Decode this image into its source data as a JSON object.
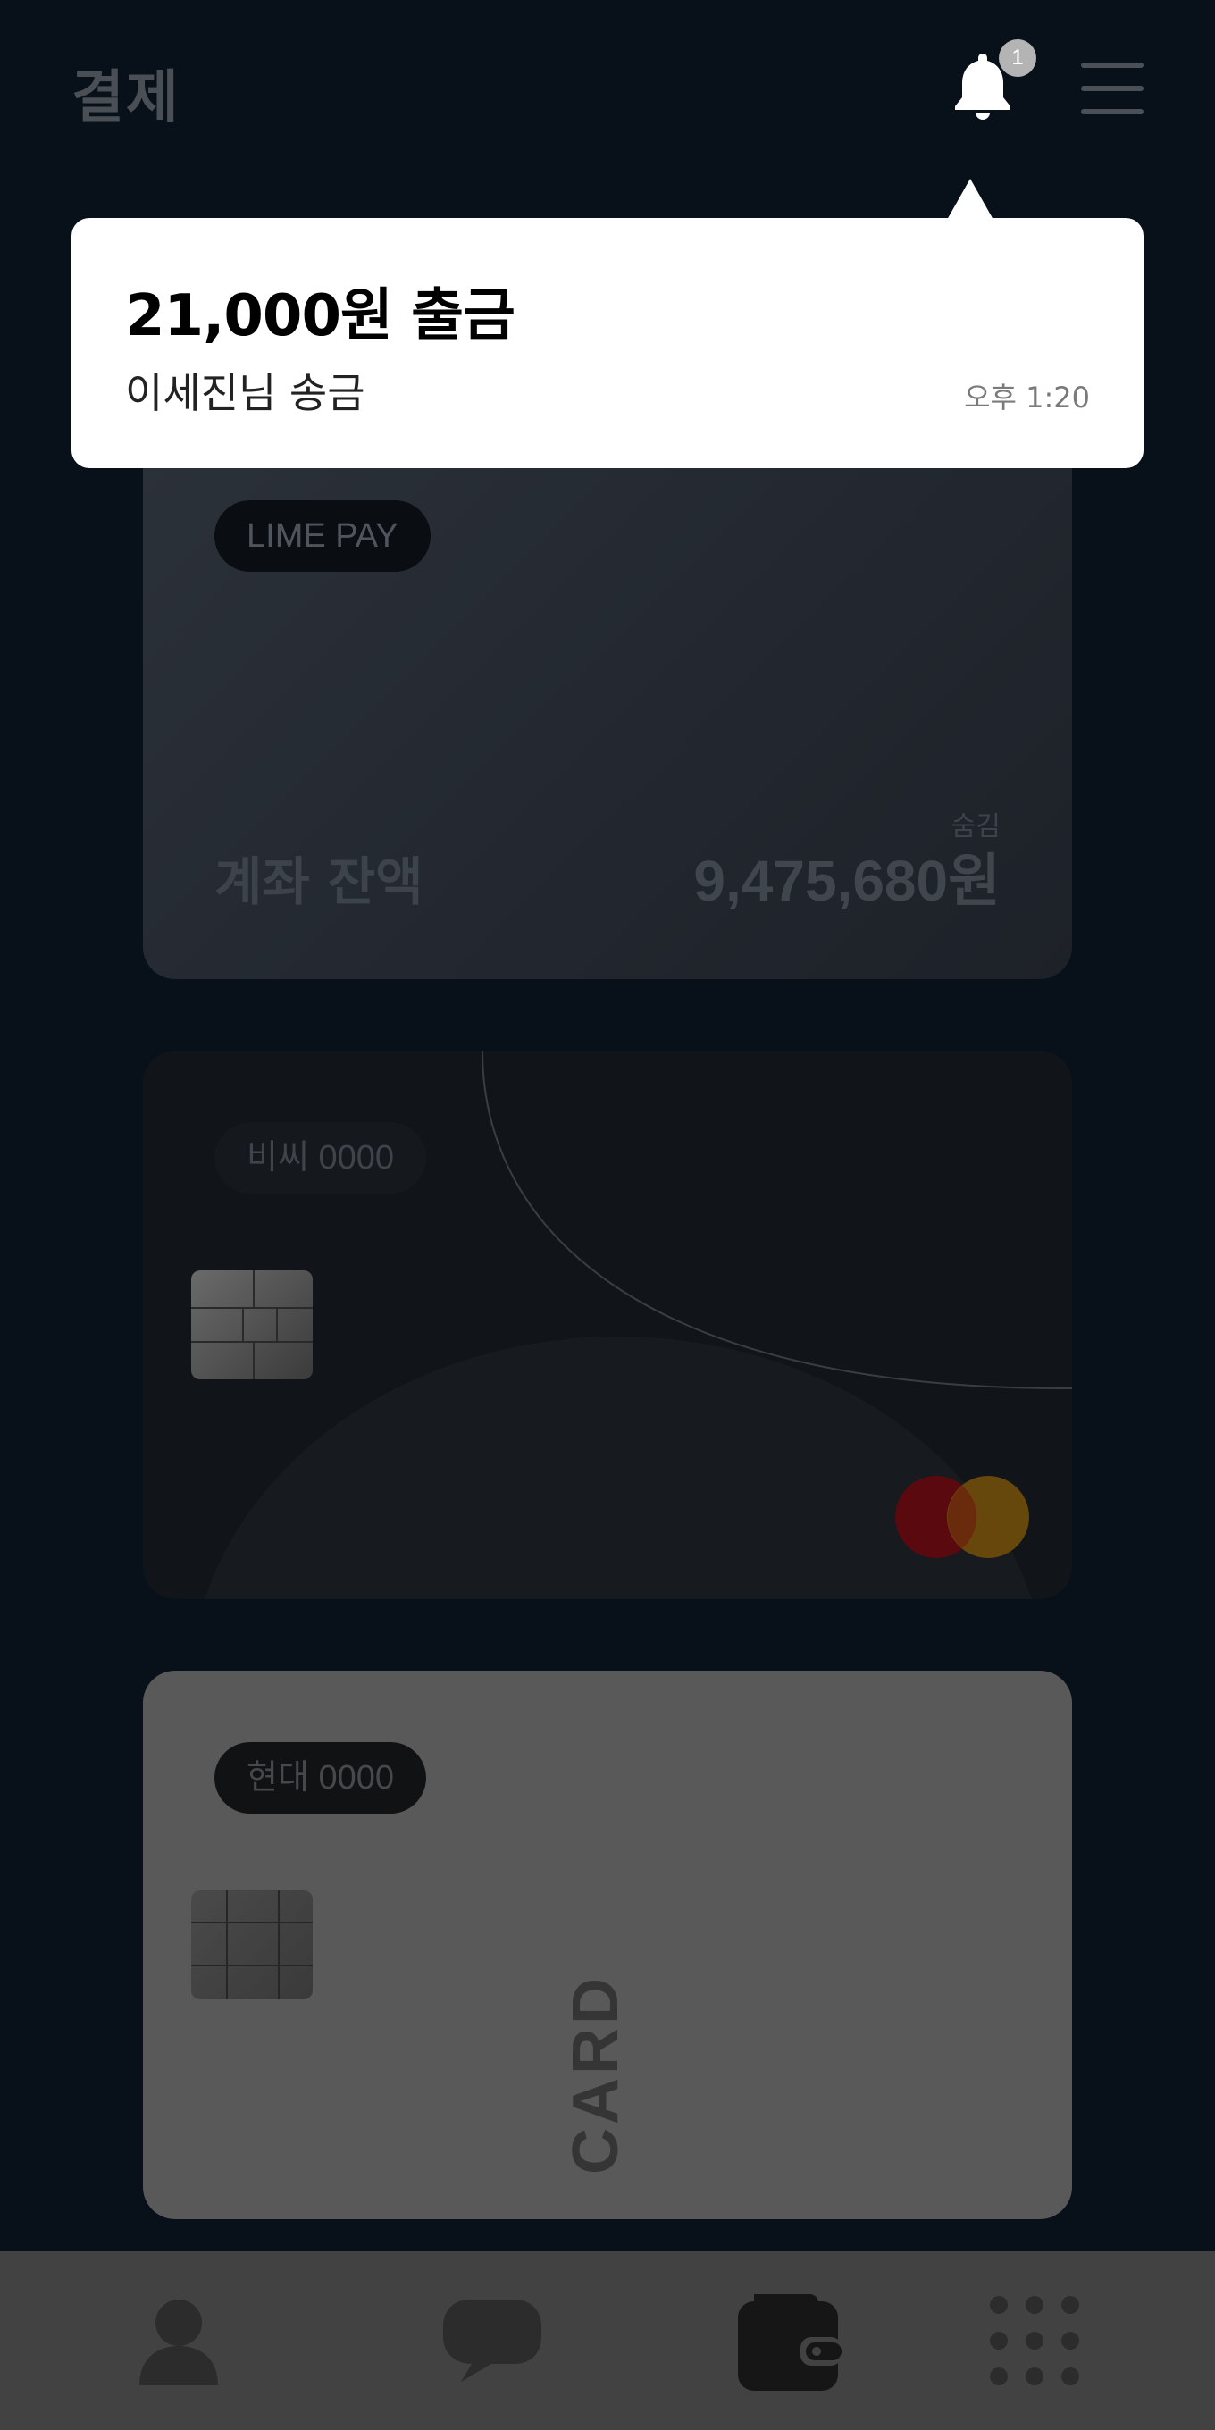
{
  "header": {
    "title": "결제",
    "notification_count": "1"
  },
  "cards": {
    "pay": {
      "label": "LIME PAY",
      "hide_label": "숨김",
      "balance_label": "계좌 잔액",
      "balance_value": "9,475,680원"
    },
    "bc": {
      "label": "비씨 0000"
    },
    "hyundai": {
      "label": "현대  0000",
      "card_word": "CARD"
    }
  },
  "notification": {
    "title": "21,000원 출금",
    "subtitle": "이세진님 송금",
    "time": "오후 1:20"
  },
  "icons": {
    "bell": "bell-icon",
    "menu": "menu-icon",
    "profile": "person-icon",
    "chat": "chat-bubble-icon",
    "wallet": "wallet-icon",
    "more": "grid-dots-icon"
  },
  "colors": {
    "background": "#081019",
    "popup": "#ffffff",
    "nav": "#424242",
    "badge": "#b4b4b4"
  }
}
